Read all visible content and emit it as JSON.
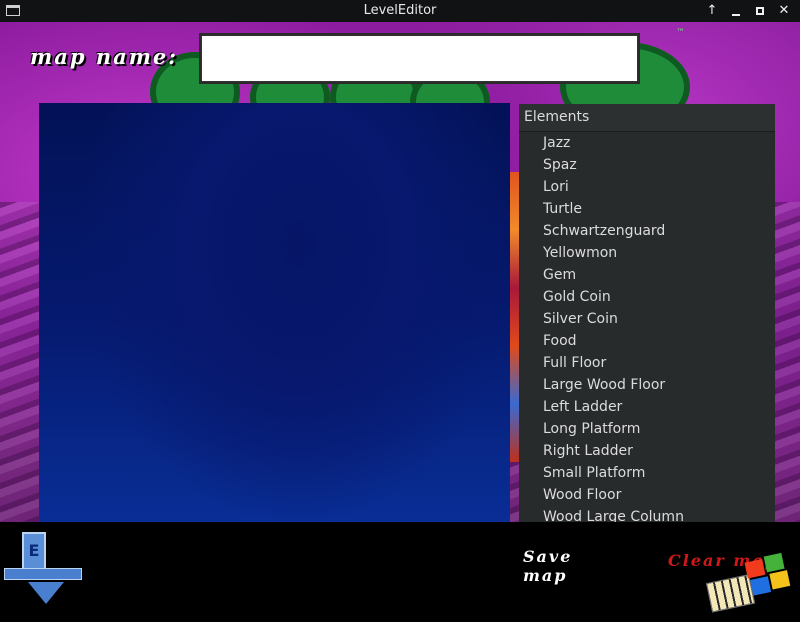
{
  "window": {
    "title": "LevelEditor",
    "controls": [
      "up-arrow-icon",
      "minimize-icon",
      "maximize-icon",
      "close-icon"
    ]
  },
  "map_name": {
    "label": "map name:",
    "value": "",
    "placeholder": ""
  },
  "elements_panel": {
    "header": "Elements",
    "items": [
      "Jazz",
      "Spaz",
      "Lori",
      "Turtle",
      "Schwartzenguard",
      "Yellowmon",
      "Gem",
      "Gold Coin",
      "Silver Coin",
      "Food",
      "Full Floor",
      "Large Wood Floor",
      "Left Ladder",
      "Long Platform",
      "Right Ladder",
      "Small Platform",
      "Wood Floor",
      "Wood Large Column"
    ]
  },
  "actions": {
    "save_label": "Save map",
    "clear_label": "Clear map"
  },
  "decor": {
    "badge_letter": "E",
    "trademark": "™"
  },
  "colors": {
    "panel_bg": "#272b2c",
    "panel_text": "#dcdcdc",
    "clear_text": "#d01818",
    "save_text": "#ffffff",
    "canvas_top": "#031257",
    "canvas_bottom": "#0a32a0"
  }
}
